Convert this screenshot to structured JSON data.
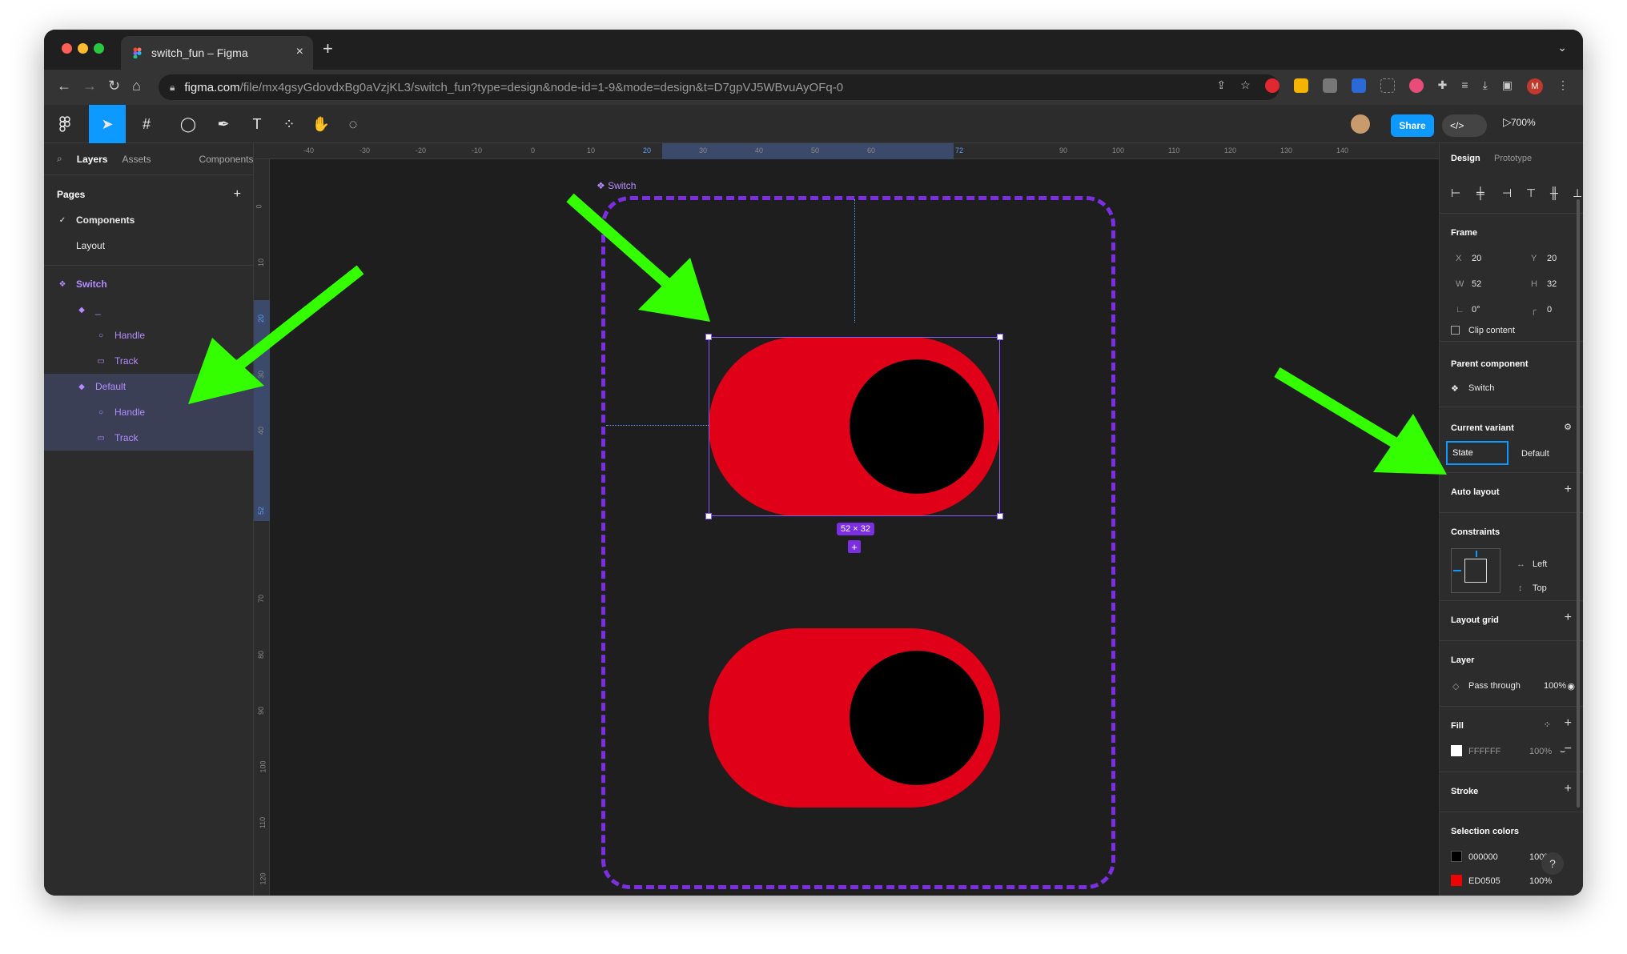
{
  "browser": {
    "tab_title": "switch_fun – Figma",
    "tab_close": "×",
    "new_tab": "+",
    "tab_chevron": "⌄",
    "url_host": "figma.com",
    "url_path": "/file/mx4gsyGdovdxBg0aVzjKL3/switch_fun?type=design&node-id=1-9&mode=design&t=D7gpVJ5WBvuAyOFq-0",
    "profile_initial": "M"
  },
  "toolbar": {
    "share_label": "Share",
    "dev_label": "</>",
    "zoom_label": "700%",
    "play_icon": "▷"
  },
  "left_panel": {
    "tabs": [
      "Layers",
      "Assets",
      "Components"
    ],
    "pages_title": "Pages",
    "pages_add": "+",
    "pages": [
      "Components",
      "Layout"
    ],
    "page_check": "✓",
    "layers": [
      {
        "label": "Switch",
        "icon": "component-set-icon"
      },
      {
        "label": "_",
        "icon": "variant-icon"
      },
      {
        "label": "Handle",
        "icon": "ellipse-icon"
      },
      {
        "label": "Track",
        "icon": "rectangle-icon"
      },
      {
        "label": "Default",
        "icon": "variant-icon"
      },
      {
        "label": "Handle",
        "icon": "ellipse-icon"
      },
      {
        "label": "Track",
        "icon": "rectangle-icon"
      }
    ]
  },
  "canvas": {
    "frame_label": "Switch",
    "size_badge": "52 × 32",
    "ruler_top": [
      "-40",
      "-30",
      "-20",
      "-10",
      "0",
      "10",
      "20",
      "30",
      "40",
      "50",
      "60",
      "72",
      "90",
      "100",
      "110",
      "120",
      "130",
      "140"
    ],
    "ruler_left": [
      "0",
      "10",
      "20",
      "30",
      "40",
      "52",
      "70",
      "80",
      "90",
      "100",
      "110",
      "120"
    ],
    "colors": {
      "switch_track": "#e00018",
      "switch_handle": "#000000",
      "frame_border": "#7b2fe0",
      "selection": "#8a5cf6",
      "arrow": "#33ff00"
    }
  },
  "right_panel": {
    "tabs": [
      "Design",
      "Prototype"
    ],
    "frame_title": "Frame",
    "x_label": "X",
    "x_value": "20",
    "y_label": "Y",
    "y_value": "20",
    "w_label": "W",
    "w_value": "52",
    "h_label": "H",
    "h_value": "32",
    "rotation_value": "0°",
    "radius_value": "0",
    "clip_content": "Clip content",
    "parent_component_title": "Parent component",
    "parent_component_value": "Switch",
    "current_variant_title": "Current variant",
    "variant_property": "State",
    "variant_value": "Default",
    "auto_layout_title": "Auto layout",
    "constraints_title": "Constraints",
    "constraint_h": "Left",
    "constraint_v": "Top",
    "layout_grid_title": "Layout grid",
    "layer_title": "Layer",
    "blend_mode": "Pass through",
    "layer_opacity": "100%",
    "fill_title": "Fill",
    "fill_hex": "FFFFFF",
    "fill_opacity": "100%",
    "stroke_title": "Stroke",
    "selection_colors_title": "Selection colors",
    "sel_color_1_hex": "000000",
    "sel_color_1_opacity": "100%",
    "sel_color_2_hex": "ED0505",
    "sel_color_2_opacity": "100%",
    "help": "?",
    "plus": "+",
    "minus": "−"
  }
}
